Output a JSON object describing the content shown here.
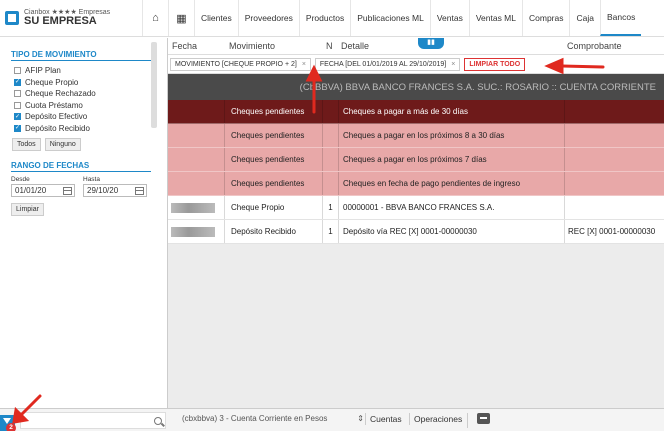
{
  "brand": {
    "line1": "Cianbox ★★★★ Empresas",
    "line2": "SU EMPRESA"
  },
  "nav": {
    "items": [
      "Clientes",
      "Proveedores",
      "Productos",
      "Publicaciones ML",
      "Ventas",
      "Ventas ML",
      "Compras",
      "Caja",
      "Bancos"
    ],
    "active": "Bancos"
  },
  "sidebar": {
    "movement_title": "TIPO DE MOVIMIENTO",
    "movements": [
      {
        "label": "AFIP Plan",
        "checked": false
      },
      {
        "label": "Cheque Propio",
        "checked": true
      },
      {
        "label": "Cheque Rechazado",
        "checked": false
      },
      {
        "label": "Cuota Préstamo",
        "checked": false
      },
      {
        "label": "Depósito Efectivo",
        "checked": true
      },
      {
        "label": "Depósito Recibido",
        "checked": true
      }
    ],
    "all_label": "Todos",
    "none_label": "Ninguno",
    "dates_title": "RANGO DE FECHAS",
    "from_label": "Desde",
    "to_label": "Hasta",
    "from_value": "01/01/20",
    "to_value": "29/10/20",
    "clear_label": "Limpiar"
  },
  "table": {
    "headers": {
      "fecha": "Fecha",
      "movimiento": "Movimiento",
      "n": "N",
      "detalle": "Detalle",
      "comprobante": "Comprobante"
    },
    "filters": {
      "movement_chip": "MOVIMIENTO [CHEQUE PROPIO + 2]",
      "date_chip": "FECHA [DEL 01/01/2019 AL 29/10/2019]",
      "clear_all": "LIMPIAR TODO"
    },
    "bank_label": "(CbBBVA) BBVA BANCO FRANCES S.A. SUC.: ROSARIO :: CUENTA CORRIENTE",
    "rows": [
      {
        "style": "dark",
        "mov": "Cheques pendientes",
        "n": "",
        "det": "Cheques a pagar a más de 30 días",
        "comp": "",
        "redacted": false
      },
      {
        "style": "light",
        "mov": "Cheques pendientes",
        "n": "",
        "det": "Cheques a pagar en los próximos 8 a 30 días",
        "comp": "",
        "redacted": false
      },
      {
        "style": "light",
        "mov": "Cheques pendientes",
        "n": "",
        "det": "Cheques a pagar en los próximos 7 días",
        "comp": "",
        "redacted": false
      },
      {
        "style": "light",
        "mov": "Cheques pendientes",
        "n": "",
        "det": "Cheques en fecha de pago pendientes de ingreso",
        "comp": "",
        "redacted": false
      },
      {
        "style": "white",
        "mov": "Cheque Propio",
        "n": "1",
        "det": "00000001 - BBVA BANCO FRANCES S.A.",
        "comp": "",
        "redacted": true
      },
      {
        "style": "white",
        "mov": "Depósito Recibido",
        "n": "1",
        "det": "Depósito vía REC [X] 0001-00000030",
        "comp": "REC [X] 0001-00000030",
        "redacted": true
      }
    ]
  },
  "bottom": {
    "badge": "2",
    "account": "(cbxbbva) 3 - Cuenta Corriente en Pesos",
    "cuentas": "Cuentas",
    "operaciones": "Operaciones"
  },
  "colors": {
    "accent": "#1e88c8",
    "dark_row": "#6e1a1a",
    "light_row": "#e8a8a8",
    "alert": "#d33"
  }
}
